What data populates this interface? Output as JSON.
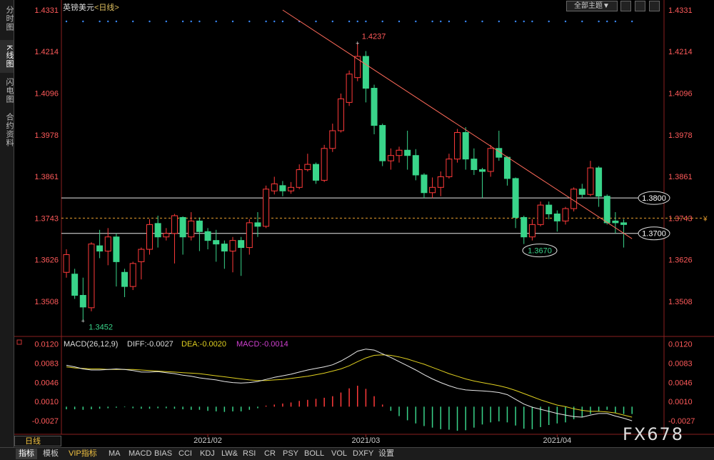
{
  "sidebar": {
    "tabs": [
      {
        "label": "分时图",
        "active": false
      },
      {
        "label": "K线图",
        "active": true
      },
      {
        "label": "闪电图",
        "active": false
      },
      {
        "label": "合约资料",
        "active": false
      }
    ]
  },
  "header": {
    "symbol": "英镑美元",
    "period": "<日线>",
    "theme_button": "全部主题▼"
  },
  "period_strip": "日线",
  "watermark": "FX678",
  "bottom_tabs": [
    "指标",
    "模板",
    "VIP指标",
    "MA",
    "MACD",
    "BIAS",
    "CCI",
    "KDJ",
    "LW&",
    "RSI",
    "CR",
    "PSY",
    "BOLL",
    "VOL",
    "DXFY",
    "设置"
  ],
  "colors": {
    "up": "#ff3a3a",
    "down": "#39d48a",
    "diff": "#e8e8e8",
    "dea": "#e0d020",
    "axis_label": "#ff5a5a",
    "grid_dot": "#3a8aff"
  },
  "chart_data": [
    {
      "type": "candlestick",
      "title": "英镑美元 <日线>",
      "y_ticks": [
        "1.4331",
        "1.4214",
        "1.4096",
        "1.3978",
        "1.3861",
        "1.3743",
        "1.3626",
        "1.3508"
      ],
      "ylim": [
        1.3415,
        1.4331
      ],
      "x_ticks": [
        "2021/02",
        "2021/03",
        "2021/04"
      ],
      "x_tick_index": [
        17,
        36,
        59
      ],
      "annotations": {
        "high_label": "1.4237",
        "low_label": "1.3452",
        "level_labels": [
          "1.3800",
          "1.3700",
          "1.3670"
        ]
      },
      "support_resistance": [
        1.38,
        1.37
      ],
      "dashed_level": 1.3743,
      "trendline": {
        "from": [
          26,
          1.4331
        ],
        "to": [
          68,
          1.3685
        ]
      },
      "candles": [
        [
          1.359,
          1.364,
          1.3575,
          1.3655
        ],
        [
          1.3585,
          1.3525,
          1.3515,
          1.36
        ],
        [
          1.3525,
          1.3492,
          1.3452,
          1.3575
        ],
        [
          1.349,
          1.367,
          1.348,
          1.3675
        ],
        [
          1.3665,
          1.365,
          1.363,
          1.371
        ],
        [
          1.365,
          1.369,
          1.361,
          1.3715
        ],
        [
          1.369,
          1.362,
          1.355,
          1.37
        ],
        [
          1.359,
          1.355,
          1.352,
          1.36
        ],
        [
          1.355,
          1.3615,
          1.354,
          1.362
        ],
        [
          1.362,
          1.3655,
          1.357,
          1.366
        ],
        [
          1.3655,
          1.3725,
          1.364,
          1.374
        ],
        [
          1.3728,
          1.369,
          1.366,
          1.375
        ],
        [
          1.369,
          1.37,
          1.368,
          1.3715
        ],
        [
          1.37,
          1.375,
          1.3615,
          1.3755
        ],
        [
          1.3745,
          1.369,
          1.364,
          1.3748
        ],
        [
          1.369,
          1.3735,
          1.368,
          1.376
        ],
        [
          1.3735,
          1.3705,
          1.365,
          1.3745
        ],
        [
          1.3705,
          1.368,
          1.3655,
          1.3715
        ],
        [
          1.368,
          1.367,
          1.362,
          1.371
        ],
        [
          1.367,
          1.365,
          1.36,
          1.368
        ],
        [
          1.365,
          1.368,
          1.359,
          1.369
        ],
        [
          1.368,
          1.366,
          1.358,
          1.369
        ],
        [
          1.366,
          1.373,
          1.364,
          1.374
        ],
        [
          1.373,
          1.372,
          1.369,
          1.376
        ],
        [
          1.372,
          1.3825,
          1.3715,
          1.3835
        ],
        [
          1.382,
          1.384,
          1.381,
          1.386
        ],
        [
          1.3835,
          1.382,
          1.3805,
          1.3848
        ],
        [
          1.382,
          1.383,
          1.3812,
          1.3845
        ],
        [
          1.383,
          1.388,
          1.3825,
          1.3895
        ],
        [
          1.388,
          1.3895,
          1.3875,
          1.3925
        ],
        [
          1.3895,
          1.385,
          1.384,
          1.39
        ],
        [
          1.385,
          1.394,
          1.3845,
          1.395
        ],
        [
          1.394,
          1.399,
          1.393,
          1.401
        ],
        [
          1.399,
          1.408,
          1.3985,
          1.4095
        ],
        [
          1.407,
          1.415,
          1.406,
          1.416
        ],
        [
          1.414,
          1.42,
          1.413,
          1.4237
        ],
        [
          1.42,
          1.411,
          1.407,
          1.4215
        ],
        [
          1.411,
          1.4005,
          1.398,
          1.412
        ],
        [
          1.4005,
          1.3905,
          1.389,
          1.401
        ],
        [
          1.3905,
          1.392,
          1.388,
          1.394
        ],
        [
          1.392,
          1.3935,
          1.39,
          1.3945
        ],
        [
          1.3935,
          1.392,
          1.388,
          1.399
        ],
        [
          1.392,
          1.3865,
          1.385,
          1.3938
        ],
        [
          1.3865,
          1.3815,
          1.38,
          1.387
        ],
        [
          1.3815,
          1.383,
          1.38,
          1.3858
        ],
        [
          1.383,
          1.386,
          1.3805,
          1.3875
        ],
        [
          1.386,
          1.391,
          1.3855,
          1.3925
        ],
        [
          1.391,
          1.3985,
          1.39,
          1.3995
        ],
        [
          1.3985,
          1.391,
          1.388,
          1.4
        ],
        [
          1.391,
          1.388,
          1.3865,
          1.394
        ],
        [
          1.388,
          1.3875,
          1.38,
          1.3885
        ],
        [
          1.3875,
          1.394,
          1.386,
          1.395
        ],
        [
          1.394,
          1.3915,
          1.3905,
          1.399
        ],
        [
          1.3915,
          1.3855,
          1.3835,
          1.3918
        ],
        [
          1.3855,
          1.3745,
          1.3715,
          1.3858
        ],
        [
          1.3745,
          1.369,
          1.367,
          1.375
        ],
        [
          1.369,
          1.3725,
          1.368,
          1.374
        ],
        [
          1.3725,
          1.378,
          1.372,
          1.379
        ],
        [
          1.378,
          1.3755,
          1.374,
          1.379
        ],
        [
          1.3755,
          1.3735,
          1.3705,
          1.3765
        ],
        [
          1.3735,
          1.377,
          1.3725,
          1.3775
        ],
        [
          1.377,
          1.3825,
          1.3762,
          1.383
        ],
        [
          1.3825,
          1.381,
          1.38,
          1.384
        ],
        [
          1.381,
          1.3885,
          1.3805,
          1.3905
        ],
        [
          1.3885,
          1.3805,
          1.3775,
          1.389
        ],
        [
          1.3805,
          1.373,
          1.3725,
          1.381
        ],
        [
          1.3735,
          1.373,
          1.37,
          1.376
        ],
        [
          1.373,
          1.3725,
          1.366,
          1.374
        ]
      ]
    },
    {
      "type": "macd",
      "title": "MACD(26,12,9)",
      "diff_label": "DIFF:-0.0027",
      "dea_label": "DEA:-0.0020",
      "macd_label": "MACD:-0.0014",
      "y_ticks": [
        "0.0120",
        "0.0083",
        "0.0046",
        "0.0010",
        "-0.0027"
      ],
      "ylim": [
        -0.005,
        0.013
      ],
      "diff": [
        0.0079,
        0.0076,
        0.0072,
        0.007,
        0.007,
        0.0071,
        0.0072,
        0.0071,
        0.0069,
        0.0066,
        0.0066,
        0.0067,
        0.0065,
        0.0063,
        0.006,
        0.0058,
        0.0055,
        0.0053,
        0.0051,
        0.0048,
        0.0046,
        0.0045,
        0.0046,
        0.0048,
        0.0052,
        0.0056,
        0.0059,
        0.0062,
        0.0066,
        0.007,
        0.0073,
        0.0076,
        0.008,
        0.0087,
        0.0096,
        0.0106,
        0.011,
        0.0108,
        0.0101,
        0.0094,
        0.0086,
        0.0078,
        0.007,
        0.0061,
        0.0053,
        0.0046,
        0.004,
        0.0035,
        0.0032,
        0.0031,
        0.003,
        0.0029,
        0.0027,
        0.0023,
        0.0014,
        0.0005,
        -0.0001,
        -0.0005,
        -0.0009,
        -0.0013,
        -0.0016,
        -0.0019,
        -0.002,
        -0.0016,
        -0.0013,
        -0.0013,
        -0.0018,
        -0.0022,
        -0.0027
      ],
      "dea": [
        0.0076,
        0.0074,
        0.0073,
        0.0072,
        0.0072,
        0.0071,
        0.0071,
        0.0071,
        0.0071,
        0.007,
        0.0069,
        0.0068,
        0.0067,
        0.0066,
        0.0065,
        0.0064,
        0.0063,
        0.0061,
        0.0059,
        0.0057,
        0.0055,
        0.0053,
        0.0051,
        0.005,
        0.005,
        0.0051,
        0.0052,
        0.0054,
        0.0056,
        0.0058,
        0.0061,
        0.0064,
        0.0068,
        0.0072,
        0.0078,
        0.0086,
        0.0093,
        0.0098,
        0.0099,
        0.0098,
        0.0095,
        0.0091,
        0.0086,
        0.0081,
        0.0075,
        0.0069,
        0.0063,
        0.0058,
        0.0053,
        0.0049,
        0.0046,
        0.0043,
        0.004,
        0.0036,
        0.0031,
        0.0025,
        0.0019,
        0.0013,
        0.0008,
        0.0003,
        0.0,
        -0.0004,
        -0.0007,
        -0.0009,
        -0.0009,
        -0.001,
        -0.0012,
        -0.0016,
        -0.002
      ],
      "macd": [
        -0.0005,
        -0.0005,
        -0.0006,
        -0.0005,
        -0.0004,
        -0.0003,
        -0.0002,
        -0.0001,
        -0.0003,
        -0.0004,
        -0.0004,
        -0.0003,
        -0.0003,
        -0.0004,
        -0.0005,
        -0.0006,
        -0.0006,
        -0.0008,
        -0.0009,
        -0.001,
        -0.0009,
        -0.0009,
        -0.0006,
        -0.0003,
        0.0002,
        0.0004,
        0.0006,
        0.0008,
        0.0011,
        0.0013,
        0.0015,
        0.0017,
        0.002,
        0.0027,
        0.0035,
        0.004,
        0.0034,
        0.002,
        0.0004,
        -0.0008,
        -0.0018,
        -0.0026,
        -0.0032,
        -0.0037,
        -0.004,
        -0.0043,
        -0.0044,
        -0.0046,
        -0.0045,
        -0.004,
        -0.0034,
        -0.003,
        -0.0028,
        -0.003,
        -0.0036,
        -0.0042,
        -0.0043,
        -0.0039,
        -0.0035,
        -0.0032,
        -0.003,
        -0.0024,
        -0.002,
        -0.0014,
        -0.0009,
        -0.0006,
        -0.0012,
        -0.0014,
        -0.0014
      ]
    }
  ]
}
